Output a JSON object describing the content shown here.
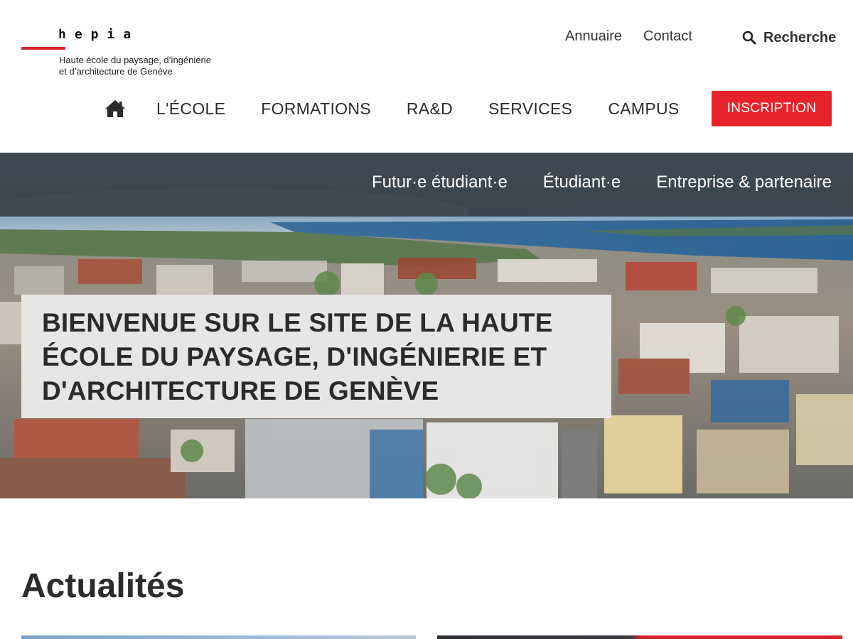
{
  "brand": {
    "logo_word": "hepia",
    "tagline_line1": "Haute école du paysage, d’ingénierie",
    "tagline_line2": "et d’architecture de Genève",
    "accent_color": "#d8232a"
  },
  "utility_nav": {
    "annuaire": "Annuaire",
    "contact": "Contact",
    "search_label": "Recherche",
    "search_icon": "search-icon"
  },
  "main_nav": {
    "home_icon": "home-icon",
    "items": [
      {
        "label": "L'ÉCOLE"
      },
      {
        "label": "FORMATIONS"
      },
      {
        "label": "RA&D"
      },
      {
        "label": "SERVICES"
      },
      {
        "label": "CAMPUS"
      }
    ],
    "cta_label": "INSCRIPTION",
    "cta_color": "#e8222b"
  },
  "audience_nav": {
    "items": [
      {
        "label": "Futur·e étudiant·e"
      },
      {
        "label": "Étudiant·e"
      },
      {
        "label": "Entreprise & partenaire"
      }
    ]
  },
  "hero": {
    "title": "BIENVENUE SUR LE SITE DE LA HAUTE ÉCOLE DU PAYSAGE, D'INGÉNIERIE ET D'ARCHITECTURE DE GENÈVE"
  },
  "news": {
    "title": "Actualités"
  }
}
